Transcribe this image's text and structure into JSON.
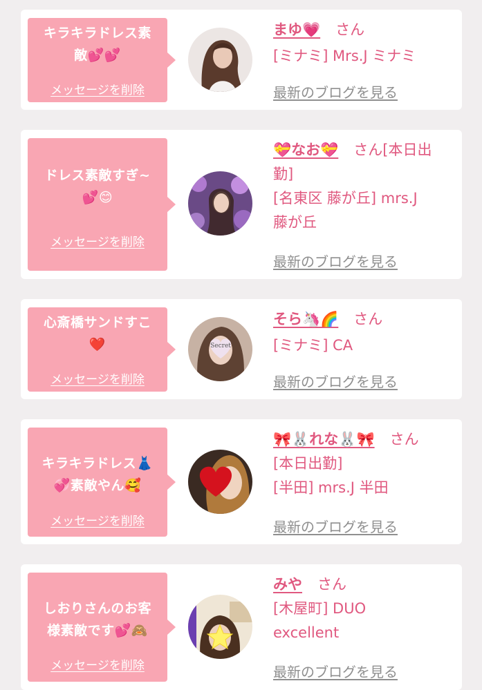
{
  "delete_label": "メッセージを削除",
  "blog_label": "最新のブログを見る",
  "san": "さん",
  "colors": {
    "background": "#f1eeef",
    "bubble": "#f9a6b3",
    "accent": "#e0587f",
    "link_gray": "#8f8f8f"
  },
  "items": [
    {
      "message_line1": "キラキラドレス素",
      "message_line2": "敵💕💕",
      "name": "まゆ💗",
      "name_tail": "",
      "shop_line1": "[ミナミ] Mrs.J ミナミ",
      "shop_line2": "",
      "avatar_icon": "woman-long-hair-photo"
    },
    {
      "message_line1": "ドレス素敵すぎ~",
      "message_line2": "💕😊",
      "name": "💝なお💝",
      "name_tail": "[本日出",
      "name_tail2": "勤]",
      "shop_line1": "[名東区 藤が丘] mrs.J",
      "shop_line2": "藤が丘",
      "avatar_icon": "woman-flowers-photo"
    },
    {
      "message_line1": "心斎橋サンドすこ",
      "message_line2": "❤️",
      "name": "そら🦄🌈",
      "name_tail": "",
      "shop_line1": "[ミナミ] CA",
      "shop_line2": "",
      "avatar_icon": "woman-secret-heart-photo"
    },
    {
      "message_line1": "キラキラドレス👗",
      "message_line2": "💞素敵やん🥰",
      "name": "🎀🐰れな🐰🎀",
      "name_tail": "",
      "shop_line1": "[本日出勤]",
      "shop_line2": "[半田] mrs.J 半田",
      "avatar_icon": "woman-heart-photo"
    },
    {
      "message_line1": "しおりさんのお客",
      "message_line2": "様素敵です💕🙈",
      "name": "みや",
      "name_tail": "",
      "shop_line1": "[木屋町] DUO",
      "shop_line2": "excellent",
      "avatar_icon": "woman-star-photo"
    }
  ]
}
